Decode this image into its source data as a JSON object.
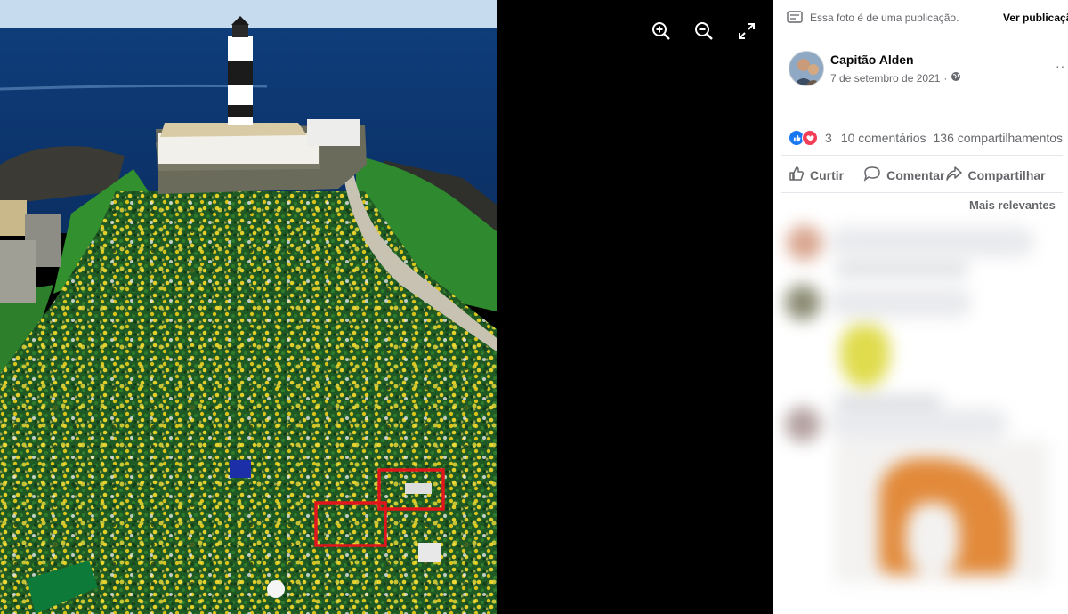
{
  "viewer": {
    "controls": [
      {
        "name": "zoom-in-icon"
      },
      {
        "name": "zoom-out-icon"
      },
      {
        "name": "fullscreen-icon"
      }
    ]
  },
  "notice": {
    "icon": "post-icon",
    "text": "Essa foto é de uma publicação.",
    "link": "Ver publicação"
  },
  "post": {
    "author": "Capitão Alden",
    "date": "7 de setembro de 2021",
    "separator": "·",
    "privacy_icon": "globe-icon"
  },
  "reactions": {
    "icons": [
      "like-icon",
      "love-icon"
    ],
    "count": "3",
    "comments": "10 comentários",
    "shares": "136 compartilhamentos"
  },
  "actions": {
    "like": "Curtir",
    "comment": "Comentar",
    "share": "Compartilhar"
  },
  "comments": {
    "sort_label": "Mais relevantes"
  },
  "colors": {
    "accent": "#1877f2",
    "love": "#f33e58",
    "muted_text": "#65676b",
    "highlight_box": "#e0161c"
  }
}
